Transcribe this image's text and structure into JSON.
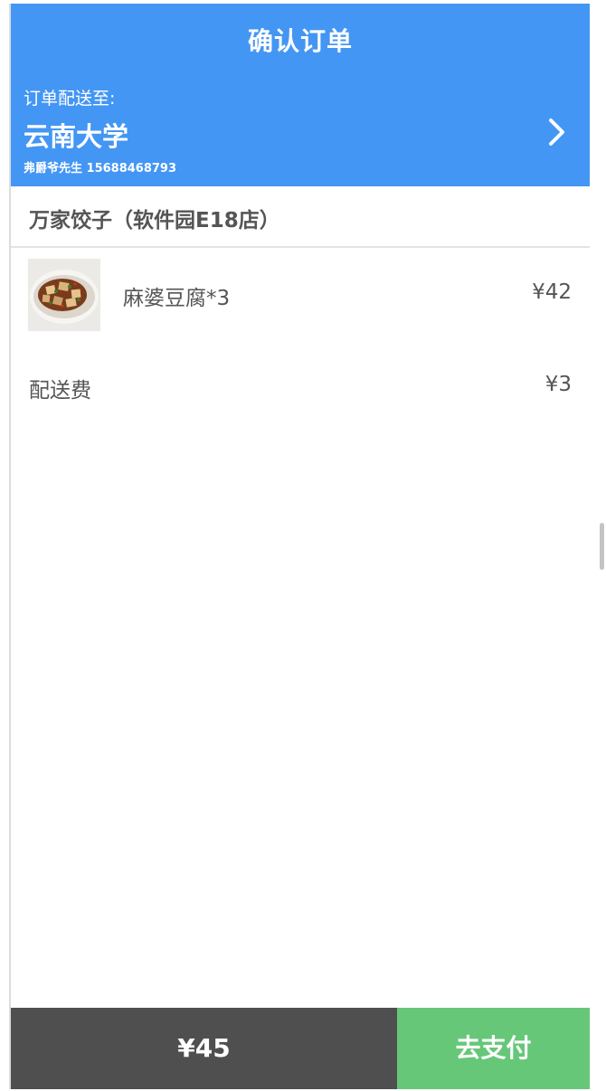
{
  "header": {
    "title": "确认订单",
    "address_label": "订单配送至:",
    "address_name": "云南大学",
    "contact": "弗爵爷先生 15688468793",
    "chevron_icon": "chevron-right-icon"
  },
  "store": {
    "name": "万家饺子（软件园E18店）"
  },
  "items": [
    {
      "name": "麻婆豆腐*3",
      "price": "¥42",
      "image_icon": "food-thumbnail"
    }
  ],
  "delivery_fee": {
    "label": "配送费",
    "value": "¥3"
  },
  "footer": {
    "total": "¥45",
    "pay_label": "去支付"
  },
  "colors": {
    "header_bg": "#4496f4",
    "total_bg": "#4f4f4f",
    "pay_bg": "#67c779",
    "text": "#555555"
  }
}
